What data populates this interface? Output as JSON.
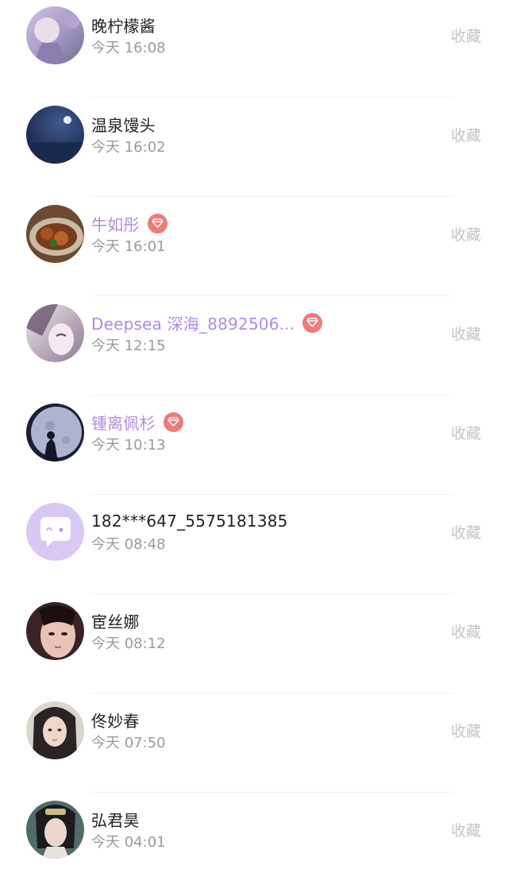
{
  "users": [
    {
      "name": "晚柠檬酱",
      "time": "今天 16:08",
      "vip": false,
      "action": "收藏",
      "avatar": "photo-avatar-pastel-girl"
    },
    {
      "name": "温泉馒头",
      "time": "今天 16:02",
      "vip": false,
      "action": "收藏",
      "avatar": "photo-avatar-night-moon"
    },
    {
      "name": "牛如彤",
      "time": "今天 16:01",
      "vip": true,
      "action": "收藏",
      "avatar": "photo-avatar-food-plate"
    },
    {
      "name": "Deepsea 深海_8892506...",
      "time": "今天 12:15",
      "vip": true,
      "action": "收藏",
      "avatar": "photo-avatar-anime-girl"
    },
    {
      "name": "锺离佩杉",
      "time": "今天 10:13",
      "vip": true,
      "action": "收藏",
      "avatar": "photo-avatar-moon-silhouette"
    },
    {
      "name": "182***647_5575181385",
      "time": "今天 08:48",
      "vip": false,
      "action": "收藏",
      "avatar": "default-chat-bubble-avatar"
    },
    {
      "name": "宦丝娜",
      "time": "今天 08:12",
      "vip": false,
      "action": "收藏",
      "avatar": "photo-avatar-girl-closeup"
    },
    {
      "name": "佟妙春",
      "time": "今天 07:50",
      "vip": false,
      "action": "收藏",
      "avatar": "photo-avatar-girl-portrait"
    },
    {
      "name": "弘君昊",
      "time": "今天 04:01",
      "vip": false,
      "action": "收藏",
      "avatar": "photo-avatar-costume-man"
    }
  ],
  "colors": {
    "name_default": "#222222",
    "name_vip": "#b08be0",
    "vip_badge": "#ee7b7a",
    "time": "#9a9a9a",
    "action": "#c4c4c4",
    "default_avatar_bg": "#d9c8f4"
  }
}
